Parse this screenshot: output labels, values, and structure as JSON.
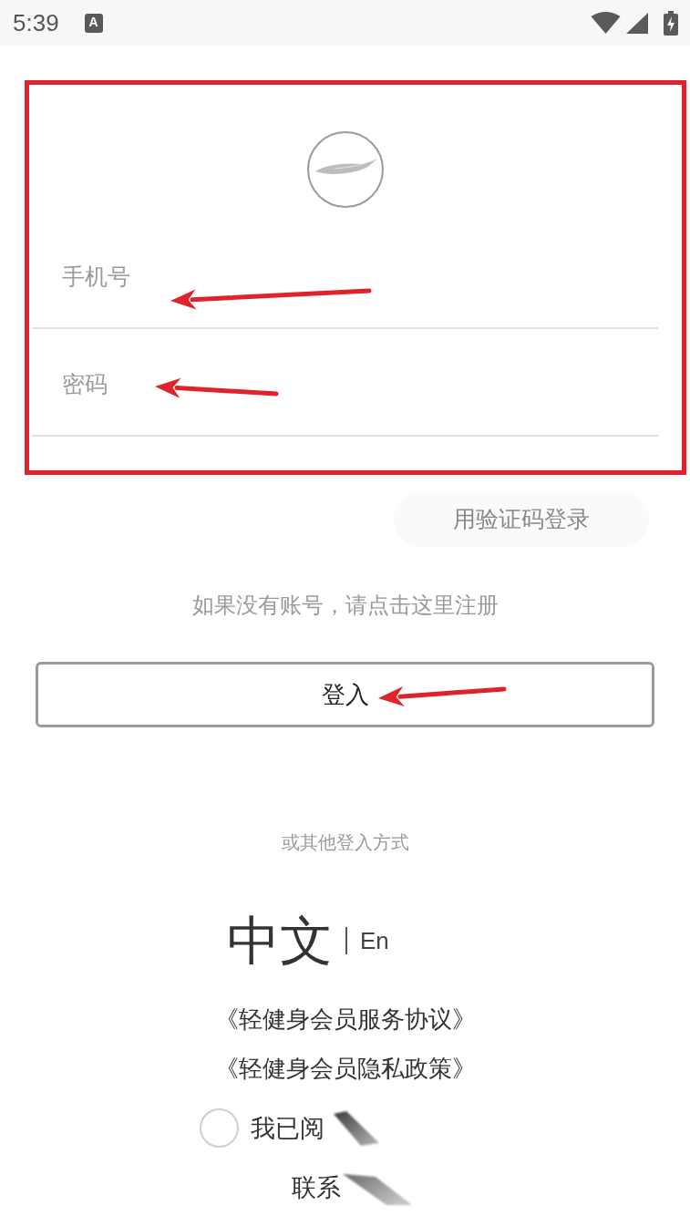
{
  "status_bar": {
    "time": "5:39",
    "notification_glyph": "A"
  },
  "login_form": {
    "fields": [
      {
        "placeholder": "手机号"
      },
      {
        "placeholder": "密码"
      }
    ]
  },
  "sms_login_button": "用验证码登录",
  "register_hint": "如果没有账号，请点击这里注册",
  "login_button": "登入",
  "other_methods_label": "或其他登入方式",
  "language_switch": [
    {
      "label": "中文",
      "selected": true
    },
    {
      "label": "En",
      "selected": false
    }
  ],
  "agreements": [
    "《轻健身会员服务协议》",
    "《轻健身会员隐私政策》"
  ],
  "consent": {
    "text": "我已阅",
    "checked": false
  },
  "contact": "联系"
}
